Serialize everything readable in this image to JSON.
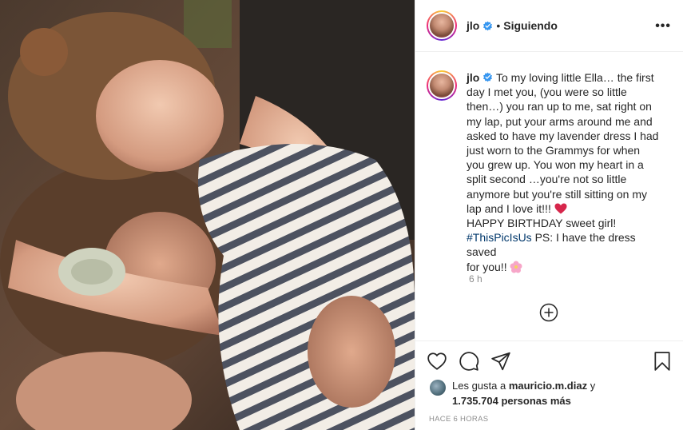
{
  "post": {
    "username": "jlo",
    "follow_status": "Siguiendo",
    "more_label": "•••",
    "caption_user": "jlo",
    "caption_lines": [
      "To my loving little Ella… the first",
      "day I met you, (you were so little",
      "then…) you ran up to me, sat right on",
      "my lap, put your arms around me and",
      "asked to have my lavender dress I had",
      "just worn to the Grammys for when",
      "you grew up. You won my heart in a",
      "split second …you're not so little",
      "anymore but you're still sitting on my",
      "lap and I love it!!!"
    ],
    "caption_birthday": "HAPPY BIRTHDAY sweet girl!",
    "caption_hashtag": "#ThisPicIsUs",
    "caption_tail": " PS: I have the dress saved",
    "caption_last": "for you!!",
    "caption_time": "6 h",
    "likes_prefix": "Les gusta a ",
    "likes_user": "mauricio.m.diaz",
    "likes_join": " y",
    "likes_count": "1.735.704 personas más",
    "posted_ago": "HACE 6 HORAS"
  },
  "colors": {
    "verified": "#3897f0",
    "hashtag": "#00376b",
    "heart_emoji": "#d6264b",
    "flower_emoji": "#f7a6c8"
  },
  "icons": [
    "verified-icon",
    "more-options-icon",
    "heart-emoji-icon",
    "flower-emoji-icon",
    "add-comment-icon",
    "like-icon",
    "comment-icon",
    "share-icon",
    "bookmark-icon"
  ]
}
